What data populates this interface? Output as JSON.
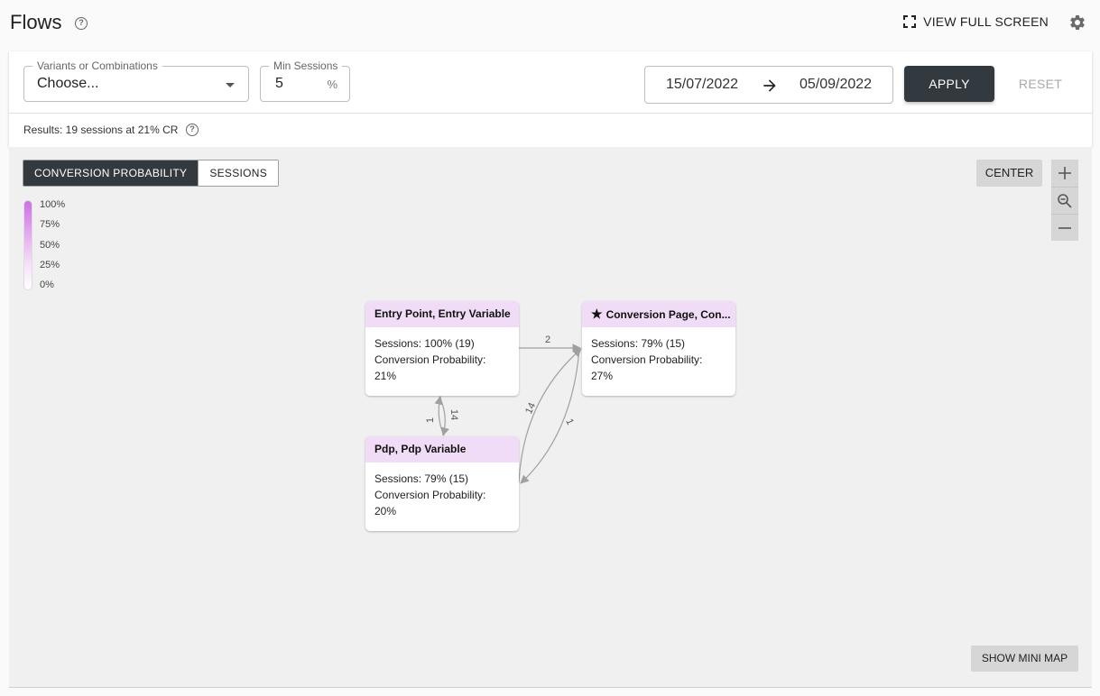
{
  "header": {
    "title": "Flows",
    "fullscreen_label": "VIEW FULL SCREEN",
    "help_glyph": "?"
  },
  "filters": {
    "variants": {
      "label": "Variants or Combinations",
      "value": "Choose..."
    },
    "min_sessions": {
      "label": "Min Sessions",
      "value": "5",
      "unit": "%"
    },
    "date_start": "15/07/2022",
    "date_end": "05/09/2022",
    "apply_label": "APPLY",
    "reset_label": "RESET",
    "results_text": "Results: 19 sessions at 21% CR"
  },
  "canvas": {
    "tabs": [
      {
        "label": "CONVERSION PROBABILITY",
        "active": true
      },
      {
        "label": "SESSIONS",
        "active": false
      }
    ],
    "legend": [
      "100%",
      "75%",
      "50%",
      "25%",
      "0%"
    ],
    "legend_colors": {
      "high": "#cf6ee8",
      "low": "#ffffff"
    },
    "center_label": "CENTER",
    "minimap_label": "SHOW MINI MAP"
  },
  "nodes": [
    {
      "title": "Entry Point, Entry Variable",
      "sessions": "Sessions: 100% (19)",
      "probability": "Conversion Probability: 21%"
    },
    {
      "title": "Conversion Page, Con...",
      "sessions": "Sessions: 79% (15)",
      "probability": "Conversion Probability: 27%",
      "icon": "star-icon"
    },
    {
      "title": "Pdp, Pdp Variable",
      "sessions": "Sessions: 79% (15)",
      "probability": "Conversion Probability: 20%"
    }
  ],
  "edges": [
    {
      "from": "Entry Point, Entry Variable",
      "to": "Conversion Page, Con...",
      "label": "2"
    },
    {
      "from": "Pdp, Pdp Variable",
      "to": "Entry Point, Entry Variable",
      "label": "14"
    },
    {
      "from": "Entry Point, Entry Variable",
      "to": "Pdp, Pdp Variable",
      "label": "1"
    },
    {
      "from": "Pdp, Pdp Variable",
      "to": "Conversion Page, Con...",
      "label": "14"
    },
    {
      "from": "Conversion Page, Con...",
      "to": "Pdp, Pdp Variable",
      "label": "1"
    }
  ],
  "colors": {
    "node_header": "#f0dcf7",
    "primary_button": "#333a3f"
  }
}
